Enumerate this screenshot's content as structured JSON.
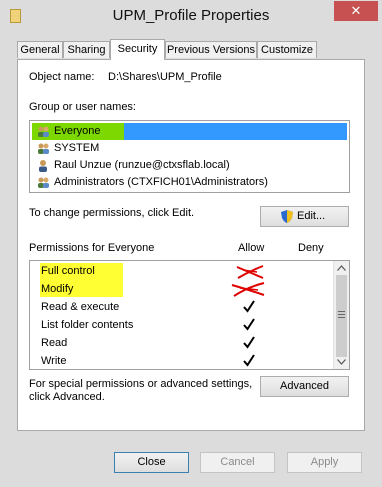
{
  "window": {
    "title": "UPM_Profile Properties",
    "close_glyph": "✕"
  },
  "tabs": [
    {
      "label": "General",
      "active": false
    },
    {
      "label": "Sharing",
      "active": false
    },
    {
      "label": "Security",
      "active": true
    },
    {
      "label": "Previous Versions",
      "active": false
    },
    {
      "label": "Customize",
      "active": false
    }
  ],
  "security": {
    "object_name_label": "Object name:",
    "object_name_value": "D:\\Shares\\UPM_Profile",
    "group_label": "Group or user names:",
    "users": [
      {
        "name": "Everyone",
        "icon": "users-group-icon",
        "selected": true
      },
      {
        "name": "SYSTEM",
        "icon": "users-group-icon",
        "selected": false
      },
      {
        "name": "Raul Unzue (runzue@ctxsflab.local)",
        "icon": "user-icon",
        "selected": false
      },
      {
        "name": "Administrators (CTXFICH01\\Administrators)",
        "icon": "users-group-icon",
        "selected": false
      }
    ],
    "change_permissions_text": "To change permissions, click Edit.",
    "edit_button": "Edit...",
    "permissions_label": "Permissions for Everyone",
    "allow_header": "Allow",
    "deny_header": "Deny",
    "permissions": [
      {
        "name": "Full control",
        "allow": false,
        "deny": false,
        "crossed": true,
        "highlighted": true
      },
      {
        "name": "Modify",
        "allow": false,
        "deny": false,
        "crossed": true,
        "highlighted": true
      },
      {
        "name": "Read & execute",
        "allow": true,
        "deny": false,
        "crossed": false,
        "highlighted": false
      },
      {
        "name": "List folder contents",
        "allow": true,
        "deny": false,
        "crossed": false,
        "highlighted": false
      },
      {
        "name": "Read",
        "allow": true,
        "deny": false,
        "crossed": false,
        "highlighted": false
      },
      {
        "name": "Write",
        "allow": true,
        "deny": false,
        "crossed": false,
        "highlighted": false
      }
    ],
    "advanced_text_line1": "For special permissions or advanced settings,",
    "advanced_text_line2": "click Advanced.",
    "advanced_button": "Advanced"
  },
  "buttons": {
    "close": "Close",
    "cancel": "Cancel",
    "apply": "Apply"
  },
  "colors": {
    "selection": "#3399ff",
    "highlight_green": "#7cd800",
    "highlight_yellow": "#ffff33",
    "cross_red": "#e00000"
  }
}
